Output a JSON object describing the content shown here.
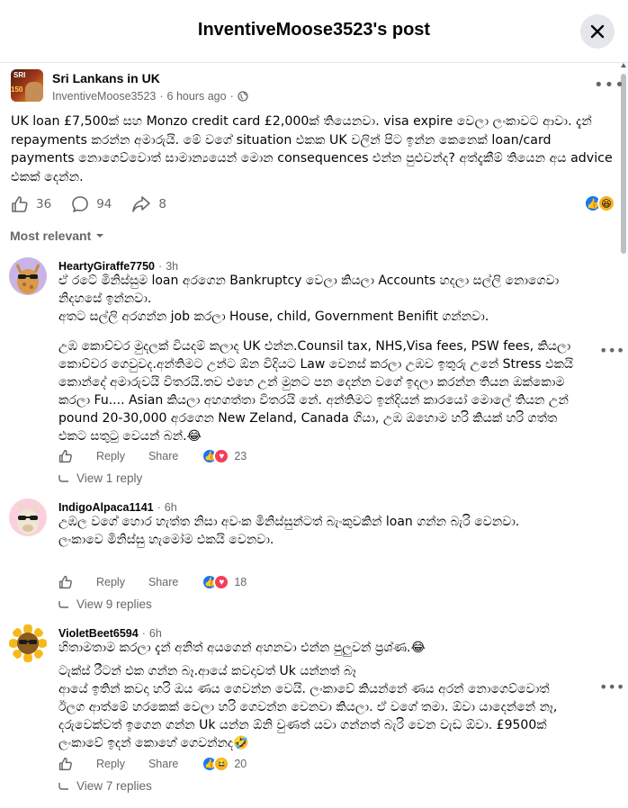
{
  "header": {
    "title": "InventiveMoose3523's post"
  },
  "post": {
    "group_name": "Sri Lankans in UK",
    "group_avatar_text": "SRI",
    "group_avatar_num": "150",
    "author": "InventiveMoose3523",
    "time": "6 hours ago",
    "text": "UK loan £7,500ක් සහ Monzo credit card £2,000ක් තියෙනවා. visa expire වෙලා ලංකාවට ආවා. දැන් repayments කරන්න අමාරුයි. මේ වගේ situation එකක UK වලින් පිට ඉන්න කෙනෙක් loan/card payments නොගෙව්වොත් සාමාන්‍යයෙන් මොන consequences එන්න පුළුවන්ද? අත්දැකීම් තියෙන අය advice එකක් දෙන්න.",
    "likes": "36",
    "comments": "94",
    "shares": "8",
    "reactions": [
      "like-icon",
      "haha-icon"
    ]
  },
  "sort_label": "Most relevant",
  "comments": [
    {
      "name": "HeartyGiraffe7750",
      "time": "3h",
      "lines": [
        "ඒ රටේ මිනිස්සුම loan අරගෙන Bankruptcy වෙලා කියලා Accounts හදලා සල්ලි නොගෙවා නිදහසේ ඉන්නවා.",
        "අතට සල්ලි අරගන්න job කරලා House, child, Government Benifit ගන්නවා.",
        "",
        "උඹ කොච්චර මුදලක් වියදම් කලාද UK එන්න.Counsil tax, NHS,Visa fees, PSW fees, කියලා කොච්චර ගෙවුවද.අන්තිමට උන්ට ඕන විදියට Law වෙනස් කරලා උඹව ඉතුරු උනේ Stress එකයි කොන්දේ අමාරුවයි විතරයි.තව එහෙ උන් මුනට පන දෙන්න වගේ ඉදලා කරන්න තියන ඔක්කොම කරලා Fu.... Asian කියලා අහගත්තා විතරයි නේ. අන්තිමට ඉන්දියන් කාරයෝ මොලේ තියන උන් pound 20-30,000 අරගෙන New Zeland, Canada ගියා, උඹ ඔහොම හරි කියක් හරි ගත්ත එකට සතුටු වෙයන් බන්.😂"
      ],
      "reply_label": "Reply",
      "share_label": "Share",
      "reaction_count": "23",
      "view_replies": "View 1 reply"
    },
    {
      "name": "IndigoAlpaca1141",
      "time": "6h",
      "lines": [
        "උඹල වගේ හොර හැත්ත නිසා අවංක මිනිස්සුන්ටත් බැංකුවකින් loan ගන්න බැරි වෙනවා.",
        "ලංකාවෙ මිනිස්සු හැමෝම එකයි වෙනවා."
      ],
      "reply_label": "Reply",
      "share_label": "Share",
      "reaction_count": "18",
      "view_replies": "View 9 replies"
    },
    {
      "name": "VioletBeet6594",
      "time": "6h",
      "lines": [
        "හිතාමතාම කරලා දැන් අනිත් අයගෙන් අහනවා එන්න පුලුවන් ප්‍රශ්ණ.😂",
        "ටැක්ස් රීටන් එක ගන්න බෑ.ආයේ කවදාවත් Uk යන්නත් බෑ",
        "ආයේ ඉතින් කවදා හරි ඔය ණය ගෙවන්න වෙයි. ලංකාවේ කියන්නේ ණය අරන් නොගෙව්වොත් ඊලග ආත්මේ හරකෙක් වෙලා හරි ගෙවන්න වෙනවා කියලා. ඒ වගේ තමා. ඕවා යාදෙන්නේ නෑ, දරුවෙක්වත් ඉගෙන ගන්න Uk යන්න ඕනි වුණත් යවා ගන්නත් බැරි වෙන වැඩ ඕවා. £9500ක් ලංකාවේ ඉදන් කොහේ ගෙවන්නද🤣"
      ],
      "reply_label": "Reply",
      "share_label": "Share",
      "reaction_count": "20",
      "view_replies": "View 7 replies"
    }
  ],
  "colors": {
    "like": "#1877f2",
    "love": "#f33e58",
    "haha": "#f7b125",
    "meta": "#65676b"
  }
}
